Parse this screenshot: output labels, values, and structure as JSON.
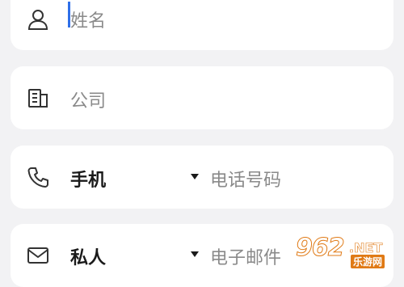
{
  "fields": {
    "name": {
      "placeholder": "姓名",
      "icon": "person-icon"
    },
    "company": {
      "placeholder": "公司",
      "icon": "building-icon"
    },
    "phone": {
      "type_label": "手机",
      "placeholder": "电话号码",
      "icon": "phone-icon"
    },
    "email": {
      "type_label": "私人",
      "placeholder": "电子邮件",
      "icon": "mail-icon"
    }
  },
  "watermark": {
    "number": "962",
    "suffix": ".NET",
    "subtitle": "乐游网"
  },
  "colors": {
    "background": "#f2f2f4",
    "card": "#ffffff",
    "cursor": "#2f6fe8",
    "placeholder": "#8a8a8a",
    "watermark": "#e07a16"
  }
}
